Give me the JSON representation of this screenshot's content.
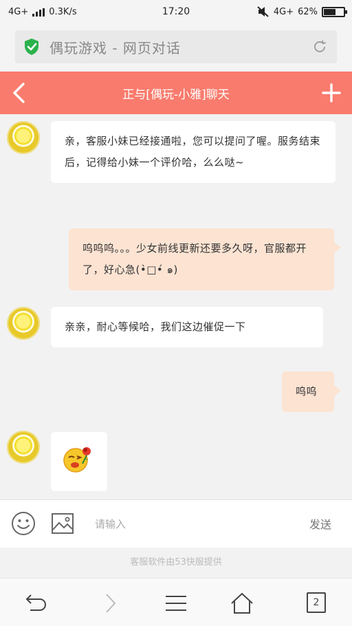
{
  "status_bar": {
    "network_left": "4G+",
    "speed": "0.3K/s",
    "time": "17:20",
    "network_right": "4G+",
    "battery": "62%",
    "battery_level": 0.62
  },
  "address_bar": {
    "title": "偶玩游戏 - 网页对话",
    "shield_color": "#2bb24c"
  },
  "header": {
    "title": "正与[偶玩-小雅]聊天",
    "background": "#f97b6d"
  },
  "messages": [
    {
      "side": "left",
      "text": "亲，客服小妹已经接通啦，您可以提问了喔。服务结束后，记得给小妹一个评价哈，么么哒~"
    },
    {
      "side": "right",
      "text": "呜呜呜。。。少女前线更新还要多久呀，官服都开了，好心急(•̀□•́ ๑)"
    },
    {
      "side": "left",
      "text": "亲亲，耐心等候哈，我们这边催促一下"
    },
    {
      "side": "right",
      "text": "呜呜"
    },
    {
      "side": "left",
      "type": "emoji",
      "icon": "rose-kiss-emoji-icon"
    }
  ],
  "input_bar": {
    "placeholder": "请输入",
    "send_label": "发送"
  },
  "provider_note": "客服软件由53快服提供",
  "browser_nav": {
    "tab_count": "2"
  }
}
